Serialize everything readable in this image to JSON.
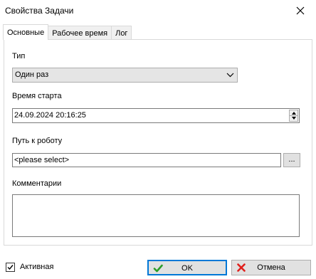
{
  "window": {
    "title": "Свойства Задачи"
  },
  "tabs": [
    {
      "label": "Основные"
    },
    {
      "label": "Рабочее время"
    },
    {
      "label": "Лог"
    }
  ],
  "fields": {
    "type_label": "Тип",
    "type_value": "Один раз",
    "start_label": "Время старта",
    "start_value": "24.09.2024 20:16:25",
    "path_label": "Путь к роботу",
    "path_value": "<please select>",
    "browse_label": "...",
    "comments_label": "Комментарии",
    "comments_value": ""
  },
  "footer": {
    "active_label": "Активная",
    "active_checked": true,
    "ok_label": "OK",
    "cancel_label": "Отмена"
  },
  "colors": {
    "ok_icon": "#2a9d2a",
    "cancel_icon": "#e0201c",
    "focus_border": "#0078d7"
  }
}
